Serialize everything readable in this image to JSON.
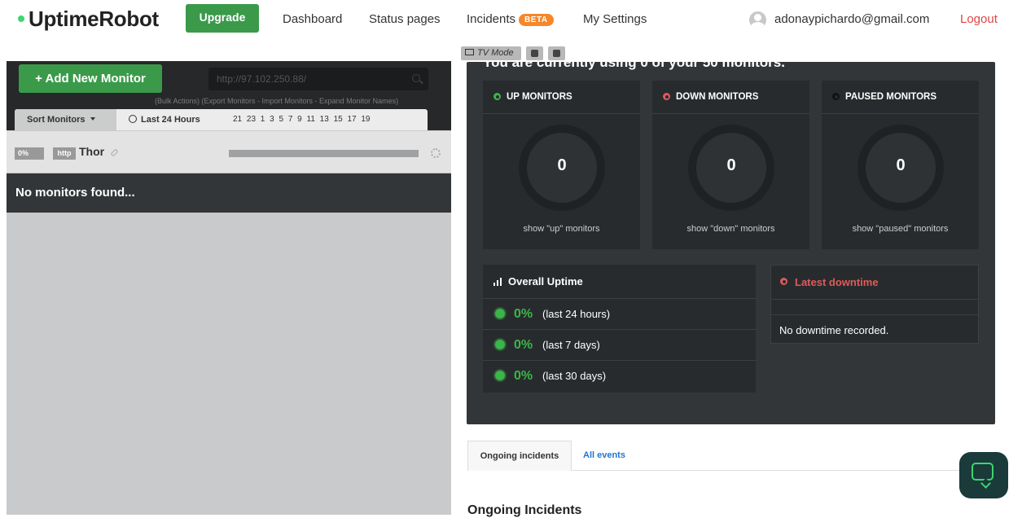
{
  "nav": {
    "brand": "UptimeRobot",
    "upgrade": "Upgrade",
    "links": [
      "Dashboard",
      "Status pages",
      "Incidents",
      "My Settings"
    ],
    "incidents_badge": "BETA",
    "user_email": "adonaypichardo@gmail.com",
    "logout": "Logout"
  },
  "left": {
    "add_button": "+ Add New Monitor",
    "search_value": "http://97.102.250.88/",
    "bulk_links": "(Bulk Actions) (Export Monitors - Import Monitors - Expand Monitor Names)",
    "sort_label": "Sort Monitors",
    "range_label": "Last 24 Hours",
    "hours": "21 23 1 3 5 7 9 11 13 15 17 19",
    "monitor": {
      "percent": "0%",
      "type": "http",
      "name": "Thor"
    },
    "empty_text": "No monitors found..."
  },
  "right": {
    "tv_mode": "TV Mode",
    "headline": "You are currently using 0 of your 50 monitors.",
    "stats": [
      {
        "title": "UP MONITORS",
        "count": "0",
        "link": "show \"up\" monitors",
        "color": "#3bb54a"
      },
      {
        "title": "DOWN MONITORS",
        "count": "0",
        "link": "show \"down\" monitors",
        "color": "#e05a5a"
      },
      {
        "title": "PAUSED MONITORS",
        "count": "0",
        "link": "show \"paused\" monitors",
        "color": "#111111"
      }
    ],
    "uptime": {
      "title": "Overall Uptime",
      "rows": [
        {
          "value": "0%",
          "note": "(last 24 hours)"
        },
        {
          "value": "0%",
          "note": "(last 7 days)"
        },
        {
          "value": "0%",
          "note": "(last 30 days)"
        }
      ]
    },
    "downtime": {
      "title": "Latest downtime",
      "text": "No downtime recorded."
    }
  },
  "tabs": {
    "active": "Ongoing incidents",
    "other": "All events"
  },
  "section_title": "Ongoing Incidents"
}
